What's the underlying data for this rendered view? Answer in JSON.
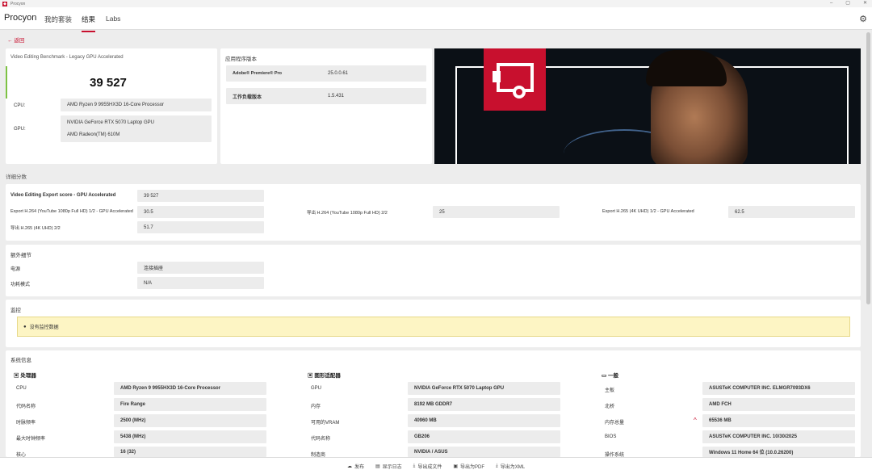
{
  "window": {
    "title": "Procyon",
    "controls": [
      "–",
      "▢",
      "✕"
    ]
  },
  "nav": {
    "brand": "Procyon",
    "items": [
      "我的套装",
      "结果",
      "Labs"
    ]
  },
  "back_label": "返回",
  "score_panel": {
    "benchmark": "Video Editing Benchmark - Legacy GPU Accelerated",
    "score": "39 527",
    "cpu_label": "CPU:",
    "cpu_value": "AMD Ryzen 9 9955HX3D 16-Core Processor",
    "gpu_label": "GPU:",
    "gpu_values": [
      "NVIDIA GeForce RTX 5070 Laptop GPU",
      "AMD Radeon(TM) 610M"
    ]
  },
  "app_version": {
    "title": "应用程序版本",
    "rows": [
      {
        "label": "Adobe® Premiere® Pro",
        "value": "25.0.0.61"
      },
      {
        "label": "工作负载版本",
        "value": "1.5.431"
      }
    ]
  },
  "details": {
    "title": "详细分数",
    "main_label": "Video Editing Export score - GPU Accelerated",
    "main_value": "39 527",
    "items": [
      {
        "label": "Export H.264 (YouTube 1080p Full HD) 1/2 - GPU Accelerated",
        "value": "30.5"
      },
      {
        "label": "导出 H.264 (YouTube 1080p Full HD) 2/2",
        "value": "25"
      },
      {
        "label": "Export H.265 (4K UHD) 1/2 - GPU Accelerated",
        "value": "62.5"
      },
      {
        "label": "导出 H.265 (4K UHD) 2/2",
        "value": "51.7"
      }
    ]
  },
  "extra": {
    "title": "额外细节",
    "rows": [
      {
        "label": "电源",
        "value": "连接插座"
      },
      {
        "label": "功耗模式",
        "value": "N/A"
      }
    ]
  },
  "monitor": {
    "title": "监控",
    "message": "没有监控数据"
  },
  "sysinfo": {
    "title": "系统信息",
    "cpu": {
      "heading": "处理器",
      "rows": [
        {
          "label": "CPU",
          "value": "AMD Ryzen 9 9955HX3D 16-Core Processor"
        },
        {
          "label": "代码名称",
          "value": "Fire Range"
        },
        {
          "label": "时脉频率",
          "value": "2500 (MHz)"
        },
        {
          "label": "最大时钟频率",
          "value": "5438 (MHz)"
        },
        {
          "label": "核心",
          "value": "16 (32)"
        }
      ]
    },
    "gpu": {
      "heading": "图形适配器",
      "rows": [
        {
          "label": "GPU",
          "value": "NVIDIA GeForce RTX 5070 Laptop GPU"
        },
        {
          "label": "内存",
          "value": "8192 MB GDDR7"
        },
        {
          "label": "可用的VRAM",
          "value": "40960 MB"
        },
        {
          "label": "代码名称",
          "value": "GB206"
        },
        {
          "label": "制造商",
          "value": "NVIDIA / ASUS"
        }
      ]
    },
    "general": {
      "heading": "一般",
      "rows": [
        {
          "label": "主板",
          "value": "ASUSTeK COMPUTER INC. ELMGR7093DX6"
        },
        {
          "label": "北桥",
          "value": "AMD FCH"
        },
        {
          "label": "内存总量",
          "value": "65536 MB"
        },
        {
          "label": "BIOS",
          "value": "ASUSTeK COMPUTER INC. 10/30/2025"
        },
        {
          "label": "操作系统",
          "value": "Windows 11 Home 64 位 (10.0.26200)"
        }
      ]
    }
  },
  "bottom_bar": [
    "发布",
    "显示日志",
    "导出成文件",
    "导出为PDF",
    "导出为XML"
  ],
  "colors": {
    "accent": "#c8102e",
    "score_bar": "#7dc243",
    "warning_bg": "#fdf5c4"
  }
}
